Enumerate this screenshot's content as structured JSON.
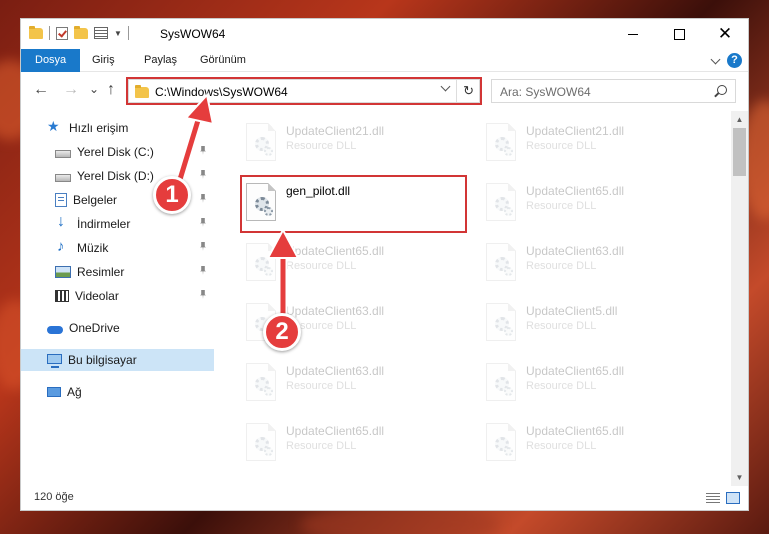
{
  "window": {
    "title": "SysWOW64",
    "controls": {
      "minimize": "",
      "maximize": "",
      "close": "✕"
    }
  },
  "ribbon": {
    "tabs": [
      {
        "label": "Dosya",
        "active": true
      },
      {
        "label": "Giriş"
      },
      {
        "label": "Paylaş"
      },
      {
        "label": "Görünüm"
      }
    ],
    "help": "?"
  },
  "address": {
    "path": "C:\\Windows\\SysWOW64",
    "search_placeholder": "Ara: SysWOW64"
  },
  "nav": {
    "back": "←",
    "forward": "→",
    "recent": "⌄",
    "up": "↑",
    "refresh": "↻"
  },
  "sidebar": {
    "items": [
      {
        "label": "Hızlı erişim",
        "icon": "star-icon"
      },
      {
        "label": "Yerel Disk (C:)",
        "icon": "drive-icon",
        "pinned": true
      },
      {
        "label": "Yerel Disk (D:)",
        "icon": "drive-icon",
        "pinned": true
      },
      {
        "label": "Belgeler",
        "icon": "documents-icon",
        "pinned": true
      },
      {
        "label": "İndirmeler",
        "icon": "download-icon",
        "pinned": true
      },
      {
        "label": "Müzik",
        "icon": "music-icon",
        "pinned": true
      },
      {
        "label": "Resimler",
        "icon": "pictures-icon",
        "pinned": true
      },
      {
        "label": "Videolar",
        "icon": "videos-icon",
        "pinned": true
      },
      {
        "label": "OneDrive",
        "icon": "cloud-icon"
      },
      {
        "label": "Bu bilgisayar",
        "icon": "computer-icon",
        "selected": true
      },
      {
        "label": "Ağ",
        "icon": "network-icon"
      }
    ]
  },
  "files": [
    {
      "name": "UpdateClient21.dll",
      "type": "Resource DLL",
      "faded": true
    },
    {
      "name": "UpdateClient21.dll",
      "type": "Resource DLL",
      "faded": true
    },
    {
      "name": "gen_pilot.dll",
      "type": "",
      "faded": false,
      "highlighted": true
    },
    {
      "name": "UpdateClient65.dll",
      "type": "Resource DLL",
      "faded": true
    },
    {
      "name": "UpdateClient65.dll",
      "type": "Resource DLL",
      "faded": true
    },
    {
      "name": "UpdateClient63.dll",
      "type": "Resource DLL",
      "faded": true
    },
    {
      "name": "UpdateClient63.dll",
      "type": "Resource DLL",
      "faded": true
    },
    {
      "name": "UpdateClient5.dll",
      "type": "Resource DLL",
      "faded": true
    },
    {
      "name": "UpdateClient63.dll",
      "type": "Resource DLL",
      "faded": true
    },
    {
      "name": "UpdateClient65.dll",
      "type": "Resource DLL",
      "faded": true
    },
    {
      "name": "UpdateClient65.dll",
      "type": "Resource DLL",
      "faded": true
    },
    {
      "name": "UpdateClient65.dll",
      "type": "Resource DLL",
      "faded": true
    }
  ],
  "status": {
    "item_count": "120 öğe"
  },
  "callouts": {
    "step1": "1",
    "step2": "2"
  },
  "colors": {
    "accent": "#1979ca",
    "highlight": "#d23535",
    "callout": "#e53d3d"
  }
}
